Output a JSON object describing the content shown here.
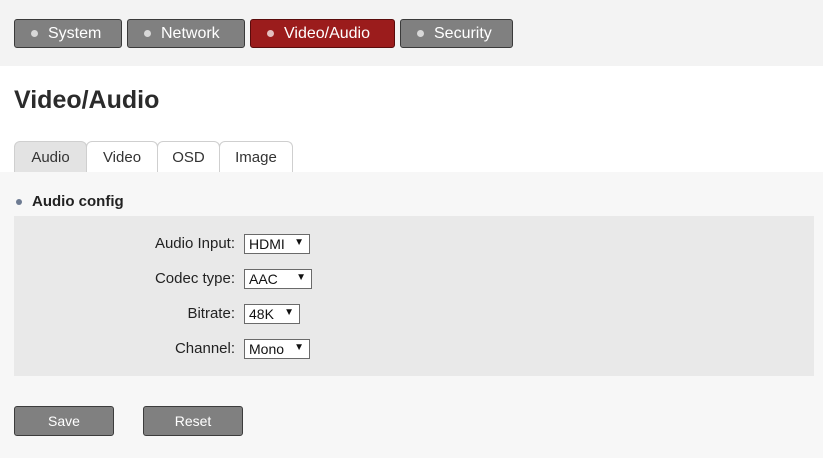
{
  "nav": {
    "items": [
      {
        "label": "System",
        "active": false
      },
      {
        "label": "Network",
        "active": false
      },
      {
        "label": "Video/Audio",
        "active": true
      },
      {
        "label": "Security",
        "active": false
      }
    ]
  },
  "page": {
    "title": "Video/Audio"
  },
  "tabs": [
    {
      "label": "Audio",
      "active": true
    },
    {
      "label": "Video",
      "active": false
    },
    {
      "label": "OSD",
      "active": false
    },
    {
      "label": "Image",
      "active": false
    }
  ],
  "section": {
    "title": "Audio config"
  },
  "form": {
    "audio_input": {
      "label": "Audio Input:",
      "value": "HDMI"
    },
    "codec_type": {
      "label": "Codec type:",
      "value": "AAC"
    },
    "bitrate": {
      "label": "Bitrate:",
      "value": "48K"
    },
    "channel": {
      "label": "Channel:",
      "value": "Mono"
    }
  },
  "actions": {
    "save_label": "Save",
    "reset_label": "Reset"
  },
  "colors": {
    "accent_active": "#9b1c1c",
    "button_gray": "#808080",
    "panel_bg": "#e9e9e9"
  },
  "icons": {
    "dropdown": "dropdown-arrow-icon"
  }
}
